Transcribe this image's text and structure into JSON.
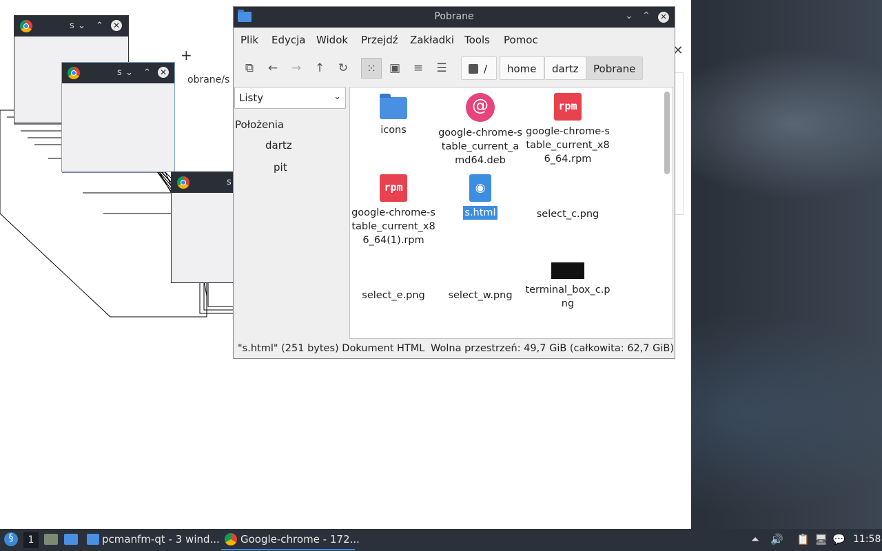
{
  "chrome_bg": {
    "new_tab": "+",
    "close": "✕",
    "url_fragment": "obrane/s"
  },
  "cascade": {
    "windows": [
      {
        "controls_min": "⌄",
        "controls_max": "⌃",
        "close": "✕",
        "ellipsis": "s"
      }
    ]
  },
  "file_manager": {
    "title": "Pobrane",
    "menu": [
      "Plik",
      "Edycja",
      "Widok",
      "Przejdź",
      "Zakładki",
      "Tools",
      "Pomoc"
    ],
    "breadcrumb": [
      "/",
      "home",
      "dartz",
      "Pobrane"
    ],
    "side_view_mode": "Listy",
    "side_heading": "Położenia",
    "side_items": [
      "dartz",
      "pit"
    ],
    "files": [
      {
        "name": "icons",
        "icon": "folder-icon"
      },
      {
        "name": "google-chrome-stable_current_amd64.deb",
        "icon": "debian-package-icon"
      },
      {
        "name": "google-chrome-stable_current_x86_64.rpm",
        "icon": "rpm-package-icon"
      },
      {
        "name": "google-chrome-stable_current_x86_64(1).rpm",
        "icon": "rpm-package-icon"
      },
      {
        "name": "s.html",
        "icon": "html-file-icon",
        "selected": true
      },
      {
        "name": "select_c.png",
        "icon": "image-file-icon"
      },
      {
        "name": "select_e.png",
        "icon": "image-file-icon"
      },
      {
        "name": "select_w.png",
        "icon": "image-file-icon"
      },
      {
        "name": "terminal_box_c.png",
        "icon": "image-file-icon"
      }
    ],
    "status_left": "\"s.html\" (251 bytes) Dokument HTML",
    "status_right": "Wolna przestrzeń: 49,7 GiB (całkowita: 62,7 GiB)"
  },
  "taskbar": {
    "desktop_number": "1",
    "task_fm": "pcmanfm-qt - 3 wind...",
    "task_chrome": "Google-chrome - 172...",
    "clock": "11:58"
  },
  "colors": {
    "accent": "#3d8ee0",
    "titlebar": "#2a2f37",
    "taskbar": "#2b313a"
  }
}
